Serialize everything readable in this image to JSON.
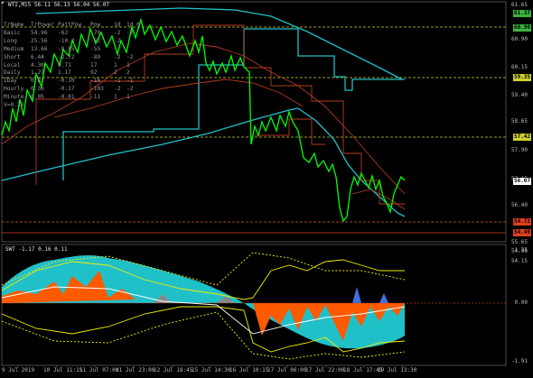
{
  "main_chart": {
    "symbol_line": "WTI,M15  56.11 56.13 56.04 56.07",
    "table": {
      "headers": [
        "TrName",
        "TrPower",
        "PattPow",
        "Pow",
        "1d",
        "1d_0"
      ],
      "rows": [
        [
          "Basic",
          "54.96",
          "-62",
          "-70",
          "-2",
          "-2"
        ],
        [
          "Long",
          "25.56",
          "-10.3",
          "-62",
          "-2",
          ""
        ],
        [
          "Medium",
          "13.66",
          "-8.85",
          "-55",
          "",
          ""
        ],
        [
          "Short",
          "6.44",
          "-2.72",
          "-89",
          "-2",
          "-2"
        ],
        [
          "Local",
          "4.30",
          "0.71",
          "17",
          "1",
          "1"
        ],
        [
          "Daily",
          "1.27",
          "1.17",
          "92",
          "2",
          "2"
        ],
        [
          "IDay",
          "0.82",
          "-0.10",
          "-16",
          "-1",
          "-1"
        ],
        [
          "Hourly",
          "0.36",
          "-0.17",
          "-103",
          "-2",
          "-2"
        ],
        [
          "Minute",
          "0.05",
          "-0.01",
          "-11",
          "1",
          "1"
        ]
      ],
      "footer": "V=0.29"
    },
    "price_labels": [
      "61.65",
      "60.90",
      "60.15",
      "59.40",
      "58.65",
      "57.90",
      "57.15",
      "56.40",
      "55.65",
      "54.90",
      "54.15"
    ],
    "tagged_prices": [
      {
        "value": "61.37",
        "color": "#3cb43c"
      },
      {
        "value": "60.90",
        "color": "#3cb43c"
      },
      {
        "value": "59.35",
        "color": "#d0d030"
      },
      {
        "value": "57.42",
        "color": "#d0d030"
      },
      {
        "value": "56.07",
        "color": "#ffffff"
      },
      {
        "value": "54.72",
        "color": "#e04020"
      },
      {
        "value": "54.49",
        "color": "#e04020"
      }
    ]
  },
  "oscillator": {
    "header": "SWT -1.17 0.16 0.11",
    "levels": [
      "1.75",
      "0.00",
      "-1.91"
    ]
  },
  "time_axis": [
    "9 Jul 2019",
    "10 Jul 11:15",
    "11 Jul 07:00",
    "11 Jul 23:00",
    "12 Jul 18:45",
    "15 Jul 14:30",
    "16 Jul 10:15",
    "17 Jul 06:00",
    "17 Jul 22:00",
    "18 Jul 17:45",
    "19 Jul 13:30"
  ],
  "colors": {
    "background": "#000000",
    "price_line": "#00ff00",
    "cyan": "#20c0c8",
    "red": "#b43c1e",
    "orange": "#ff5a00",
    "yellow": "#f0f000",
    "blue": "#4070e0",
    "grid": "#3c3c3c"
  }
}
